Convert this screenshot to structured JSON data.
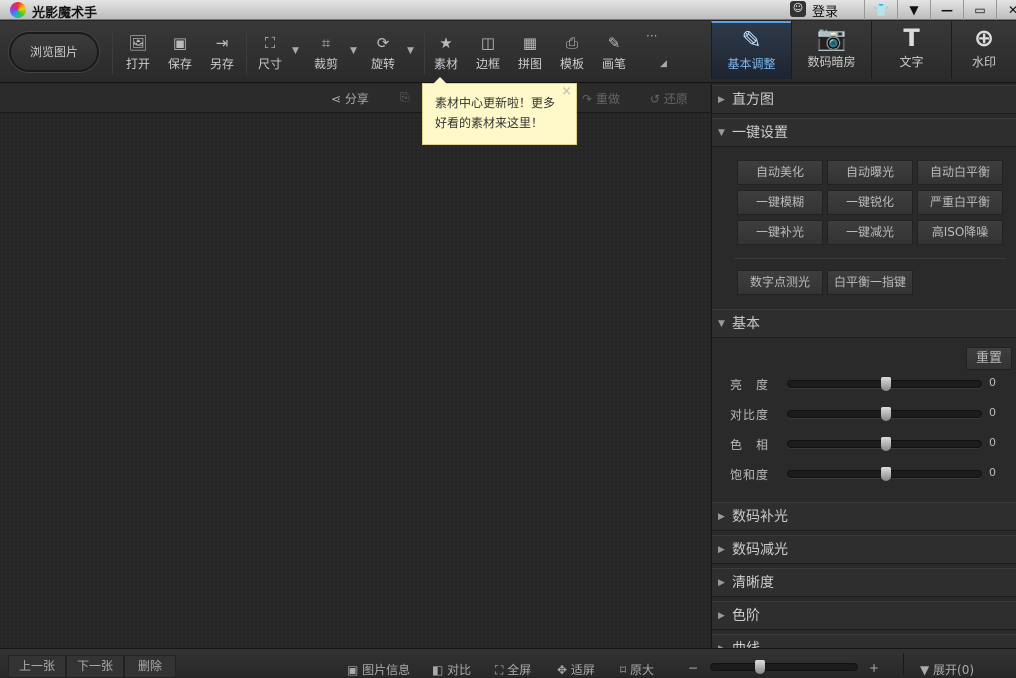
{
  "window": {
    "title": "光影魔术手",
    "login": "登录",
    "buttons": {
      "skin": "skin-icon",
      "menu": "menu-icon",
      "minimize": "minimize-icon",
      "maximize": "maximize-icon",
      "close": "close-icon"
    }
  },
  "toolbar": {
    "browse": "浏览图片",
    "tools": [
      {
        "label": "打开",
        "icon": "open-icon"
      },
      {
        "label": "保存",
        "icon": "save-icon"
      },
      {
        "label": "另存",
        "icon": "save-as-icon"
      },
      {
        "label": "尺寸",
        "icon": "resize-icon"
      },
      {
        "label": "裁剪",
        "icon": "crop-icon"
      },
      {
        "label": "旋转",
        "icon": "rotate-icon"
      },
      {
        "label": "素材",
        "icon": "material-icon"
      },
      {
        "label": "边框",
        "icon": "frame-icon"
      },
      {
        "label": "拼图",
        "icon": "collage-icon"
      },
      {
        "label": "模板",
        "icon": "template-icon"
      },
      {
        "label": "画笔",
        "icon": "brush-icon"
      }
    ],
    "more": "···",
    "right_tabs": [
      {
        "label": "基本调整",
        "icon": "adjust-icon",
        "active": true
      },
      {
        "label": "数码暗房",
        "icon": "darkroom-icon"
      },
      {
        "label": "文字",
        "icon": "text-icon"
      },
      {
        "label": "水印",
        "icon": "watermark-icon"
      }
    ]
  },
  "subbar": {
    "share": "分享",
    "redo": "重做",
    "restore": "还原"
  },
  "tooltip": {
    "text": "素材中心更新啦！更多好看的素材来这里！",
    "close": "×"
  },
  "panel": {
    "histogram": "直方图",
    "oneclick": {
      "title": "一键设置",
      "buttons": [
        "自动美化",
        "自动曝光",
        "自动白平衡",
        "一键模糊",
        "一键锐化",
        "严重白平衡",
        "一键补光",
        "一键减光",
        "高ISO降噪"
      ],
      "extra": [
        "数字点测光",
        "白平衡一指键"
      ]
    },
    "basic": {
      "title": "基本",
      "reset": "重置",
      "sliders": [
        {
          "label": "亮　度",
          "value": 0
        },
        {
          "label": "对比度",
          "value": 0
        },
        {
          "label": "色　相",
          "value": 0
        },
        {
          "label": "饱和度",
          "value": 0
        }
      ]
    },
    "sections": [
      "数码补光",
      "数码减光",
      "清晰度",
      "色阶",
      "曲线"
    ]
  },
  "bottombar": {
    "prev": "上一张",
    "next": "下一张",
    "delete": "删除",
    "info": "图片信息",
    "compare": "对比",
    "fullscreen": "全屏",
    "fit": "适屏",
    "original": "原大",
    "zoom_minus": "−",
    "zoom_plus": "+",
    "expand": "展开(0)",
    "zoom_level": 0.33
  },
  "colors": {
    "accent": "#5aa0e6",
    "tooltip_bg": "#fff8c8"
  }
}
